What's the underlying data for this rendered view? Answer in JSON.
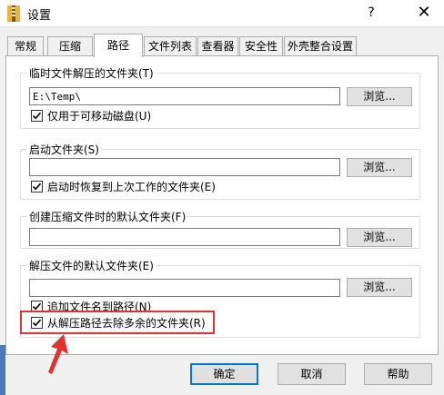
{
  "window": {
    "title": "设置",
    "help_label": "?",
    "close_label": "✕"
  },
  "tabs": [
    {
      "label": "常规"
    },
    {
      "label": "压缩"
    },
    {
      "label": "路径"
    },
    {
      "label": "文件列表"
    },
    {
      "label": "查看器"
    },
    {
      "label": "安全性"
    },
    {
      "label": "外壳整合设置"
    }
  ],
  "groups": {
    "temp": {
      "label": "临时文件解压的文件夹(T)",
      "path_value": "E:\\Temp\\",
      "browse_label": "浏览...",
      "checkbox_label": "仅用于可移动磁盘(U)",
      "checked": true
    },
    "startup": {
      "label": "启动文件夹(S)",
      "path_value": "",
      "browse_label": "浏览...",
      "checkbox_label": "启动时恢复到上次工作的文件夹(E)",
      "checked": true
    },
    "create": {
      "label": "创建压缩文件时的默认文件夹(F)",
      "path_value": "",
      "browse_label": "浏览..."
    },
    "extract": {
      "label": "解压文件的默认文件夹(E)",
      "path_value": "",
      "browse_label": "浏览...",
      "append_label": "追加文件名到路径(N)",
      "append_checked": true,
      "remove_label": "从解压路径去除多余的文件夹(R)",
      "remove_checked": true
    }
  },
  "buttons": {
    "ok": "确定",
    "cancel": "取消",
    "help": "帮助"
  },
  "colors": {
    "highlight_box": "#e0332f",
    "arrow": "#e0332f",
    "default_button_border": "#0078d7"
  }
}
